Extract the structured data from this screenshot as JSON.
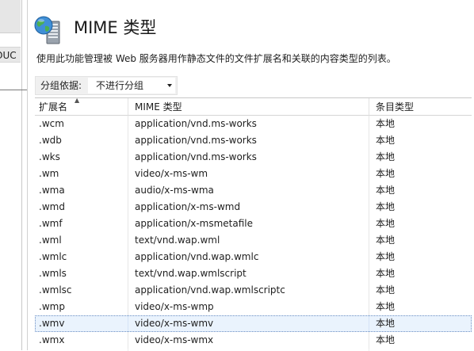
{
  "left_pane": {
    "item_text": "OUC"
  },
  "header": {
    "title": "MIME 类型",
    "description": "使用此功能管理被 Web 服务器用作静态文件的文件扩展名和关联的内容类型的列表。"
  },
  "group_by": {
    "label": "分组依据:",
    "selected": "不进行分组"
  },
  "table": {
    "columns": [
      "扩展名",
      "MIME 类型",
      "条目类型"
    ],
    "sorted_column": "扩展名",
    "rows": [
      {
        "ext": ".wcm",
        "mime": "application/vnd.ms-works",
        "type": "本地"
      },
      {
        "ext": ".wdb",
        "mime": "application/vnd.ms-works",
        "type": "本地"
      },
      {
        "ext": ".wks",
        "mime": "application/vnd.ms-works",
        "type": "本地"
      },
      {
        "ext": ".wm",
        "mime": "video/x-ms-wm",
        "type": "本地"
      },
      {
        "ext": ".wma",
        "mime": "audio/x-ms-wma",
        "type": "本地"
      },
      {
        "ext": ".wmd",
        "mime": "application/x-ms-wmd",
        "type": "本地"
      },
      {
        "ext": ".wmf",
        "mime": "application/x-msmetafile",
        "type": "本地"
      },
      {
        "ext": ".wml",
        "mime": "text/vnd.wap.wml",
        "type": "本地"
      },
      {
        "ext": ".wmlc",
        "mime": "application/vnd.wap.wmlc",
        "type": "本地"
      },
      {
        "ext": ".wmls",
        "mime": "text/vnd.wap.wmlscript",
        "type": "本地"
      },
      {
        "ext": ".wmlsc",
        "mime": "application/vnd.wap.wmlscriptc",
        "type": "本地"
      },
      {
        "ext": ".wmp",
        "mime": "video/x-ms-wmp",
        "type": "本地"
      },
      {
        "ext": ".wmv",
        "mime": "video/x-ms-wmv",
        "type": "本地",
        "selected": true
      },
      {
        "ext": ".wmx",
        "mime": "video/x-ms-wmx",
        "type": "本地"
      }
    ]
  },
  "icons": {
    "header_icon": "globe-server-icon"
  },
  "colors": {
    "selection_bg": "#eaf3fd",
    "selection_border": "#6b8fc4"
  }
}
